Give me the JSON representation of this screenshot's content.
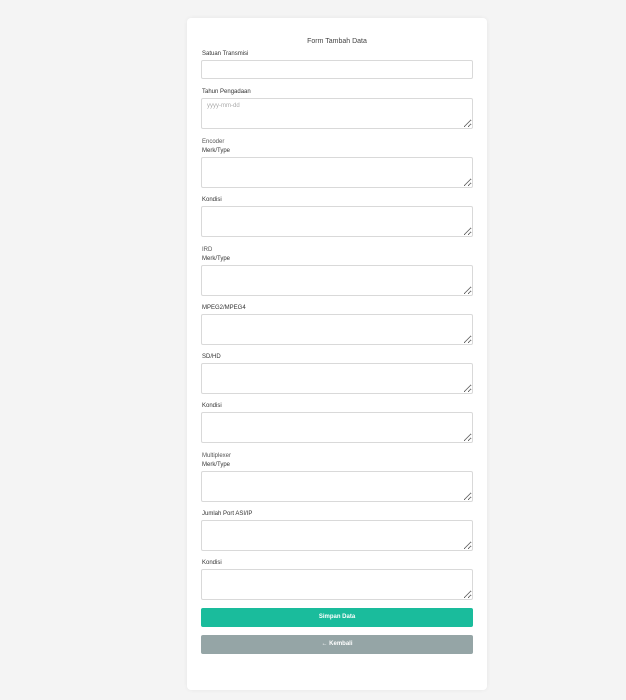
{
  "form": {
    "title": "Form Tambah Data",
    "satuan_transmisi": {
      "label": "Satuan Transmisi",
      "value": ""
    },
    "tahun_pengadaan": {
      "label": "Tahun Pengadaan",
      "placeholder": "yyyy-mm-dd"
    },
    "encoder": {
      "heading": "Encoder",
      "merk_type": {
        "label": "Merk/Type"
      },
      "kondisi": {
        "label": "Kondisi"
      }
    },
    "ird": {
      "heading": "IRD",
      "merk_type": {
        "label": "Merk/Type"
      },
      "mpeg": {
        "label": "MPEG2/MPEG4"
      },
      "sdhd": {
        "label": "SD/HD"
      },
      "kondisi": {
        "label": "Kondisi"
      }
    },
    "multiplexer": {
      "heading": "Multiplexer",
      "merk_type": {
        "label": "Merk/Type"
      },
      "jumlah_port": {
        "label": "Jumlah Port ASI/IP"
      },
      "kondisi": {
        "label": "Kondisi"
      }
    },
    "submit_label": "Simpan Data",
    "back_label": "← Kembali"
  },
  "colors": {
    "submit": "#1abc9c",
    "back": "#95a5a6",
    "background": "#f4f4f4"
  }
}
